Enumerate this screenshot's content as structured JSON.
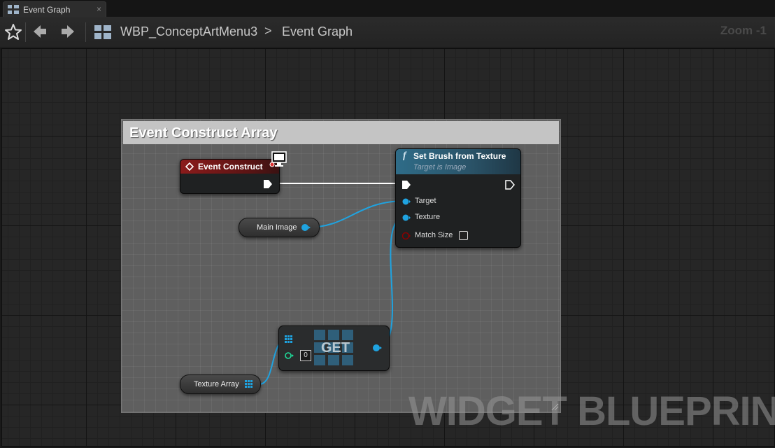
{
  "tab": {
    "label": "Event Graph",
    "close": "×"
  },
  "breadcrumb": {
    "blueprint": "WBP_ConceptArtMenu3",
    "separator": ">",
    "graph": "Event Graph"
  },
  "zoom": "Zoom -1",
  "comment": {
    "title": "Event Construct Array"
  },
  "nodes": {
    "event_construct": {
      "title": "Event Construct"
    },
    "set_brush": {
      "title": "Set Brush from Texture",
      "subtitle": "Target is Image",
      "pins": {
        "target": "Target",
        "texture": "Texture",
        "match_size": "Match Size"
      }
    },
    "main_image": {
      "label": "Main Image"
    },
    "get": {
      "label": "GET",
      "index": "0"
    },
    "texture_array": {
      "label": "Texture Array"
    }
  },
  "watermark": "WIDGET BLUEPRINT",
  "colors": {
    "object_pin": "#1fa3e0",
    "exec_wire": "#ffffff",
    "int_pin": "#1fdc9a",
    "bool_pin": "#8b0000"
  }
}
